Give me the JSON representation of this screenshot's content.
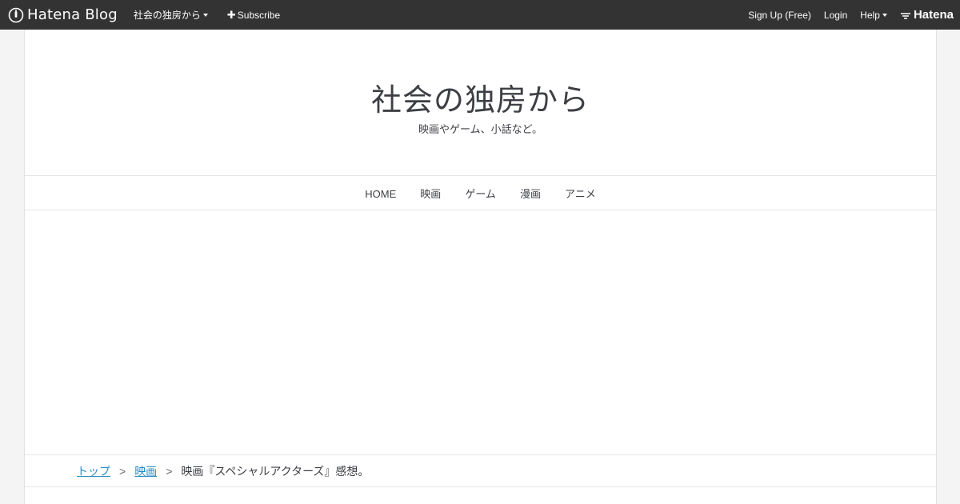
{
  "globalbar": {
    "logo_text": "Hatena Blog",
    "blog_name": "社会の独房から",
    "subscribe_label": "Subscribe",
    "signup_label": "Sign Up (Free)",
    "login_label": "Login",
    "help_label": "Help",
    "hatena_label": "Hatena",
    "bar_color": "#333333"
  },
  "header": {
    "title": "社会の独房から",
    "description": "映画やゲーム、小話など。"
  },
  "nav": {
    "items": [
      {
        "label": "HOME"
      },
      {
        "label": "映画"
      },
      {
        "label": "ゲーム"
      },
      {
        "label": "漫画"
      },
      {
        "label": "アニメ"
      }
    ]
  },
  "breadcrumb": {
    "top_label": "トップ",
    "separator": ">",
    "category_label": "映画",
    "current_label": "映画『スペシャルアクターズ』感想。",
    "link_color": "#2a8ec3"
  }
}
